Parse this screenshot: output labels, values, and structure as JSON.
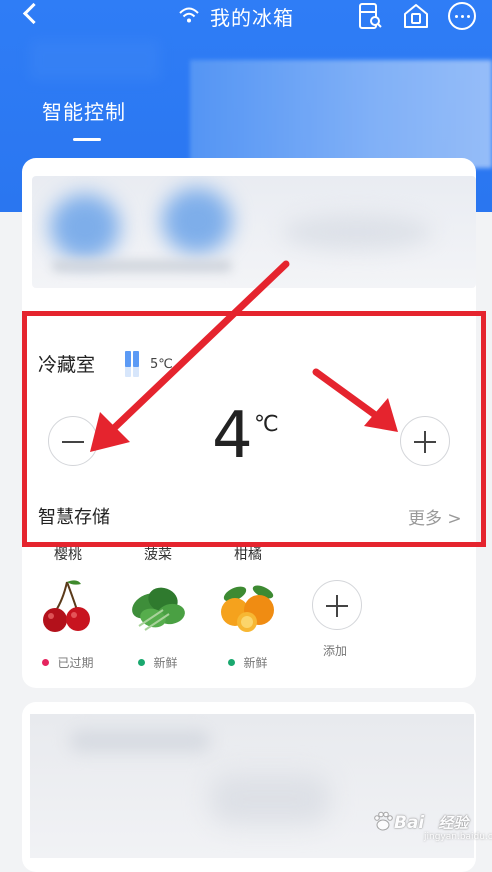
{
  "header": {
    "title": "我的冰箱",
    "tab": "智能控制"
  },
  "compartment": {
    "name": "冷藏室",
    "set_temperature": "5℃",
    "current_temperature": "4",
    "unit": "℃",
    "smart_storage": "智慧存储",
    "more": "更多 >"
  },
  "foods": [
    {
      "name": "樱桃",
      "status": "已过期",
      "status_color": "#e5245e",
      "icon": "cherry-icon"
    },
    {
      "name": "菠菜",
      "status": "新鲜",
      "status_color": "#1aa86f",
      "icon": "spinach-icon"
    },
    {
      "name": "柑橘",
      "status": "新鲜",
      "status_color": "#1aa86f",
      "icon": "orange-icon"
    }
  ],
  "add_label": "添加",
  "watermark": {
    "brand": "Bai",
    "brand2": "经验",
    "sub": "jingyan.baidu.com"
  },
  "colors": {
    "primary": "#2f7df6",
    "highlight": "#e5242e"
  }
}
